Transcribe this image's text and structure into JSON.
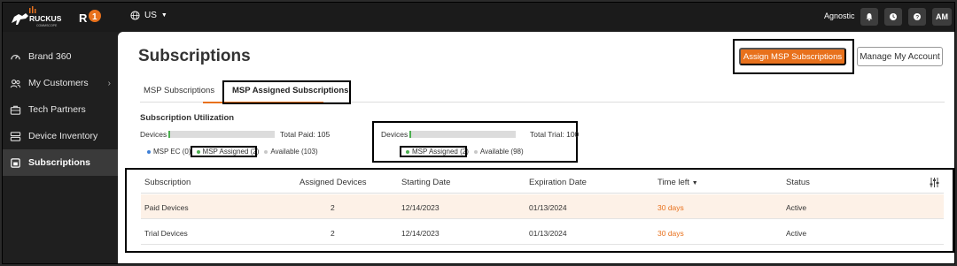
{
  "header": {
    "brand": "RUCKUS",
    "brand_sub": "COMMSCOPE",
    "region": "US",
    "account_name": "Agnostic",
    "user_initials": "AM"
  },
  "sidebar": {
    "items": [
      {
        "label": "Brand 360",
        "icon": "gauge-icon"
      },
      {
        "label": "My Customers",
        "icon": "users-icon"
      },
      {
        "label": "Tech Partners",
        "icon": "briefcase-icon"
      },
      {
        "label": "Device Inventory",
        "icon": "server-icon"
      },
      {
        "label": "Subscriptions",
        "icon": "subscription-icon"
      }
    ]
  },
  "main": {
    "title": "Subscriptions",
    "assign_button": "Assign MSP Subscriptions",
    "manage_button": "Manage My Account",
    "tabs": [
      {
        "label": "MSP Subscriptions"
      },
      {
        "label": "MSP Assigned Subscriptions"
      }
    ],
    "utilization": {
      "title": "Subscription Utilization",
      "paid": {
        "devices_label": "Devices",
        "total_label": "Total Paid: 105",
        "fill_fraction": 0.02,
        "legend": [
          "MSP EC (0)",
          "MSP Assigned (2)",
          "Available (103)"
        ]
      },
      "trial": {
        "devices_label": "Devices",
        "total_label": "Total Trial: 100",
        "fill_fraction": 0.02,
        "legend": [
          "MSP Assigned (2)",
          "Available (98)"
        ]
      }
    },
    "table": {
      "headers": [
        "Subscription",
        "Assigned Devices",
        "Starting Date",
        "Expiration Date",
        "Time left",
        "Status"
      ],
      "rows": [
        [
          "Paid Devices",
          "2",
          "12/14/2023",
          "01/13/2024",
          "30 days",
          "Active"
        ],
        [
          "Trial Devices",
          "2",
          "12/14/2023",
          "01/13/2024",
          "30 days",
          "Active"
        ]
      ]
    }
  },
  "colors": {
    "accent": "#e8711c",
    "bar_fill": "#4caf50",
    "legend_ec": "#3f7fd6",
    "legend_assigned": "#4caf50",
    "legend_available": "#c8c8c8"
  }
}
